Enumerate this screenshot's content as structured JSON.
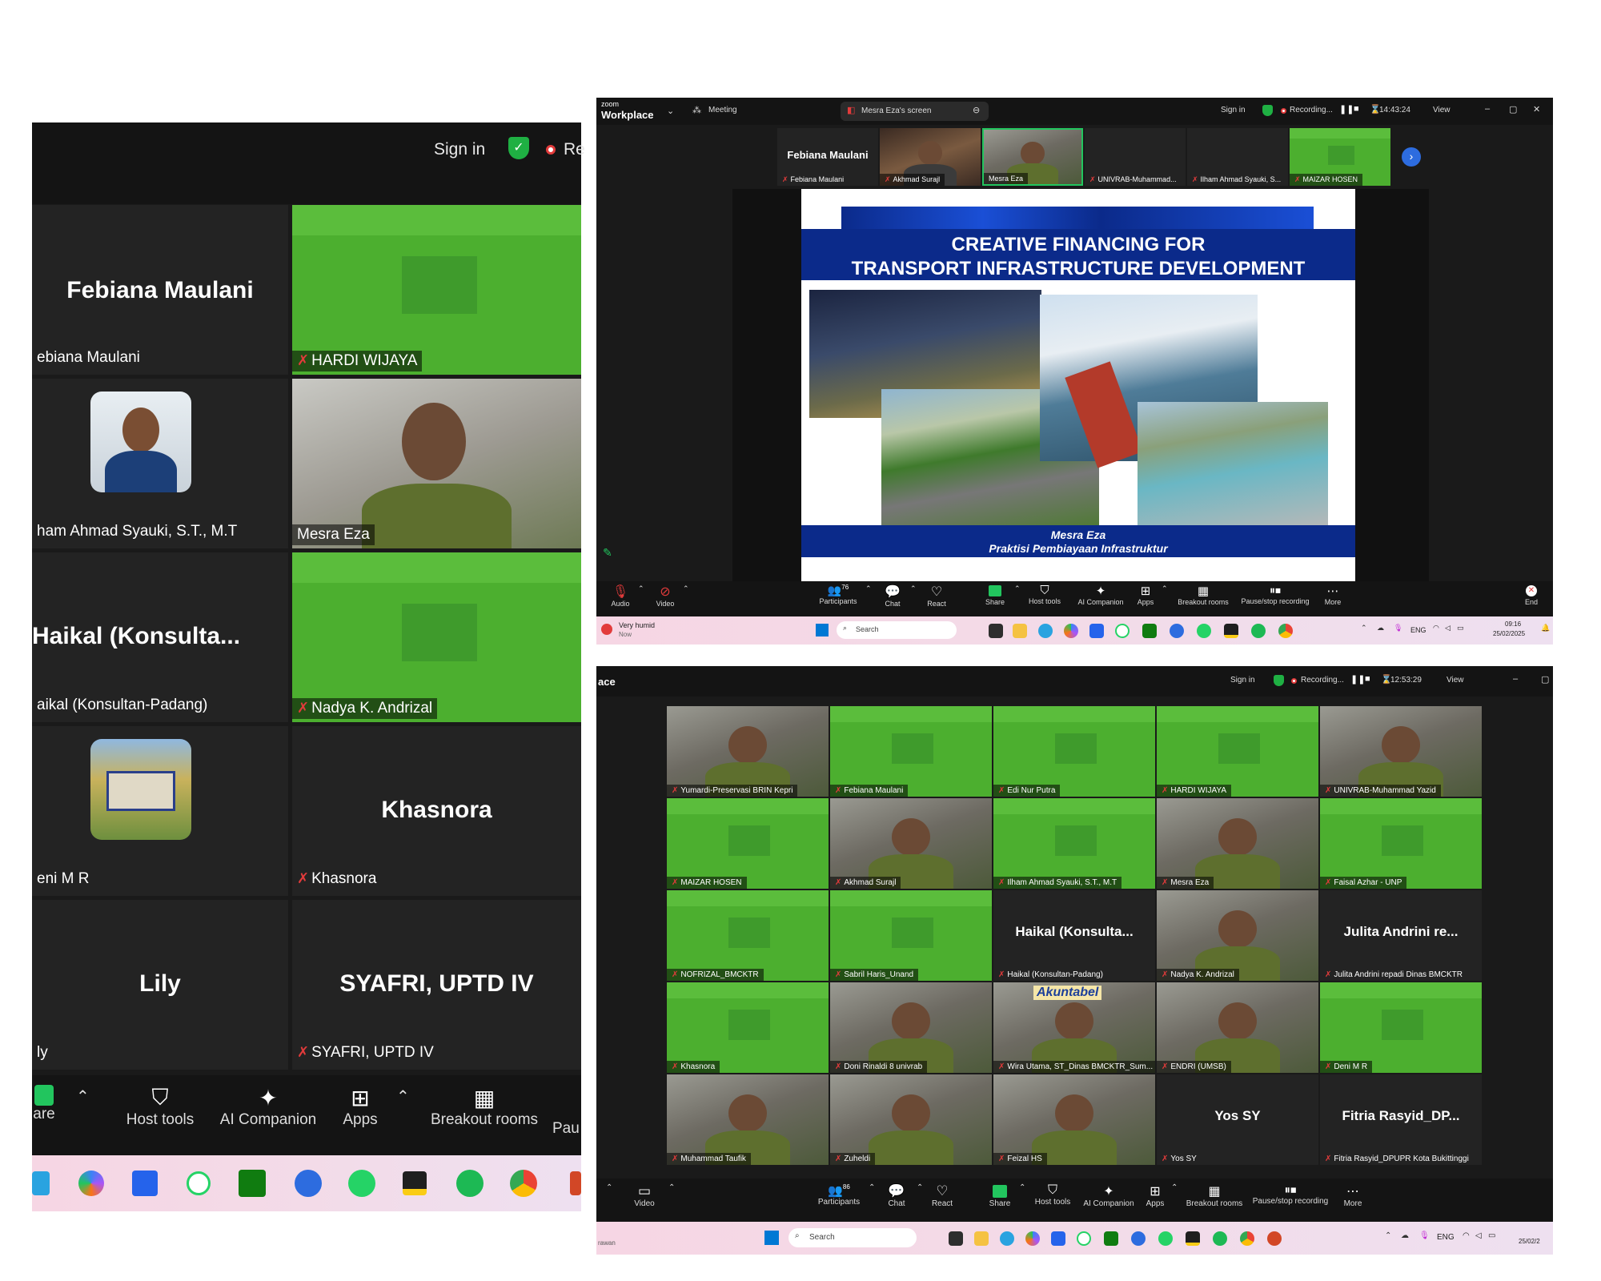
{
  "colors": {
    "zoom_dark": "#1a1a1a",
    "tile_dark": "#232323",
    "green_bg": "#4caf2f",
    "slide_blue": "#0b2a8a",
    "taskbar_pink": "#f6d6e4",
    "share_green": "#22c55e",
    "end_red": "#e23b3b",
    "shield_green": "#1fb043"
  },
  "left_panel": {
    "topbar": {
      "sign_in": "Sign in",
      "recording_partial": "Re"
    },
    "tiles": [
      {
        "big": "Febiana Maulani",
        "label": "ebiana Maulani"
      },
      {
        "label": "HARDI WIJAYA"
      },
      {
        "label": "ham Ahmad Syauki, S.T., M.T"
      },
      {
        "label": "Mesra Eza"
      },
      {
        "big": "Haikal  (Konsulta...",
        "label": "aikal (Konsultan-Padang)"
      },
      {
        "label": "Nadya K. Andrizal"
      },
      {
        "label": "eni M R"
      },
      {
        "big": "Khasnora",
        "label": "Khasnora"
      },
      {
        "big": "Lily",
        "label": "ly"
      },
      {
        "big": "SYAFRI,  UPTD  IV",
        "label": "SYAFRI, UPTD IV"
      }
    ],
    "toolbar": {
      "share_partial": "are",
      "host_tools": "Host tools",
      "ai_companion": "AI Companion",
      "apps": "Apps",
      "breakout_rooms": "Breakout rooms",
      "pause_partial": "Pau"
    }
  },
  "top_right": {
    "titlebar": {
      "app": "Workplace",
      "app_small": "zoom",
      "meeting": "Meeting",
      "screen_tab": "Mesra Eza's screen",
      "sign_in": "Sign in",
      "recording": "Recording...",
      "timer": "14:43:24",
      "view": "View"
    },
    "filmstrip": [
      {
        "big": "Febiana Maulani",
        "label": "Febiana Maulani"
      },
      {
        "label": "Akhmad Surajl"
      },
      {
        "label": "Mesra Eza"
      },
      {
        "label": "UNIVRAB-Muhammad..."
      },
      {
        "label": "Ilham Ahmad Syauki, S..."
      },
      {
        "label": "MAIZAR HOSEN"
      }
    ],
    "slide": {
      "title_line1": "CREATIVE FINANCING FOR",
      "title_line2": "TRANSPORT INFRASTRUCTURE DEVELOPMENT",
      "presenter": "Mesra Eza",
      "presenter_role": "Praktisi Pembiayaan Infrastruktur"
    },
    "toolbar": {
      "audio": "Audio",
      "video": "Video",
      "participants": "Participants",
      "participants_count": "76",
      "chat": "Chat",
      "react": "React",
      "share": "Share",
      "host_tools": "Host tools",
      "ai_companion": "AI Companion",
      "apps": "Apps",
      "breakout_rooms": "Breakout rooms",
      "pause_stop": "Pause/stop recording",
      "more": "More",
      "end": "End"
    },
    "taskbar": {
      "weather": "Very humid",
      "weather_sub": "Now",
      "search": "Search",
      "lang": "ENG",
      "time": "09:16",
      "date": "25/02/2025"
    }
  },
  "bottom_right": {
    "titlebar": {
      "app_partial": "ace",
      "sign_in": "Sign in",
      "recording": "Recording...",
      "timer": "12:53:29",
      "view": "View"
    },
    "grid": [
      {
        "label": "Yumardi-Preservasi BRIN Kepri",
        "kind": "photo"
      },
      {
        "label": "Febiana Maulani",
        "kind": "green"
      },
      {
        "label": "Edi Nur Putra",
        "kind": "green"
      },
      {
        "label": "HARDI WIJAYA",
        "kind": "green"
      },
      {
        "label": "UNIVRAB-Muhammad Yazid",
        "kind": "photo"
      },
      {
        "label": "MAIZAR HOSEN",
        "kind": "green"
      },
      {
        "label": "Akhmad Surajl",
        "kind": "photo"
      },
      {
        "label": "Ilham Ahmad Syauki, S.T., M.T",
        "kind": "green"
      },
      {
        "label": "Mesra Eza",
        "kind": "photo"
      },
      {
        "label": "Faisal Azhar - UNP",
        "kind": "green"
      },
      {
        "label": "NOFRIZAL_BMCKTR",
        "kind": "green"
      },
      {
        "label": "Sabril Haris_Unand",
        "kind": "green"
      },
      {
        "label": "Haikal (Konsultan-Padang)",
        "big": "Haikal  (Konsulta...",
        "kind": "dark"
      },
      {
        "label": "Nadya K. Andrizal",
        "kind": "photo"
      },
      {
        "label": "Julita Andrini repadi Dinas BMCKTR",
        "big": "Julita  Andrini  re...",
        "kind": "dark"
      },
      {
        "label": "Khasnora",
        "kind": "green"
      },
      {
        "label": "Doni Rinaldi 8 univrab",
        "kind": "photo"
      },
      {
        "label": "Wira Utama, ST_Dinas BMCKTR_Sum...",
        "kind": "photo",
        "banner": "Akuntabel"
      },
      {
        "label": "ENDRI (UMSB)",
        "kind": "photo"
      },
      {
        "label": "Deni M R",
        "kind": "green"
      },
      {
        "label": "Muhammad Taufik",
        "kind": "photo"
      },
      {
        "label": "Zuheldi",
        "kind": "photo"
      },
      {
        "label": "Feizal HS",
        "kind": "photo"
      },
      {
        "label": "Yos SY",
        "big": "Yos  SY",
        "kind": "dark"
      },
      {
        "label": "Fitria Rasyid_DPUPR Kota Bukittinggi",
        "big": "Fitria  Rasyid_DP...",
        "kind": "dark"
      }
    ],
    "toolbar": {
      "video": "Video",
      "participants": "Participants",
      "participants_count": "86",
      "chat": "Chat",
      "react": "React",
      "share": "Share",
      "host_tools": "Host tools",
      "ai_companion": "AI Companion",
      "apps": "Apps",
      "breakout_rooms": "Breakout rooms",
      "pause_stop": "Pause/stop recording",
      "more": "More"
    },
    "taskbar": {
      "search": "Search",
      "lang": "ENG",
      "date_partial": "25/02/2",
      "weather_partial": "rawan"
    }
  }
}
